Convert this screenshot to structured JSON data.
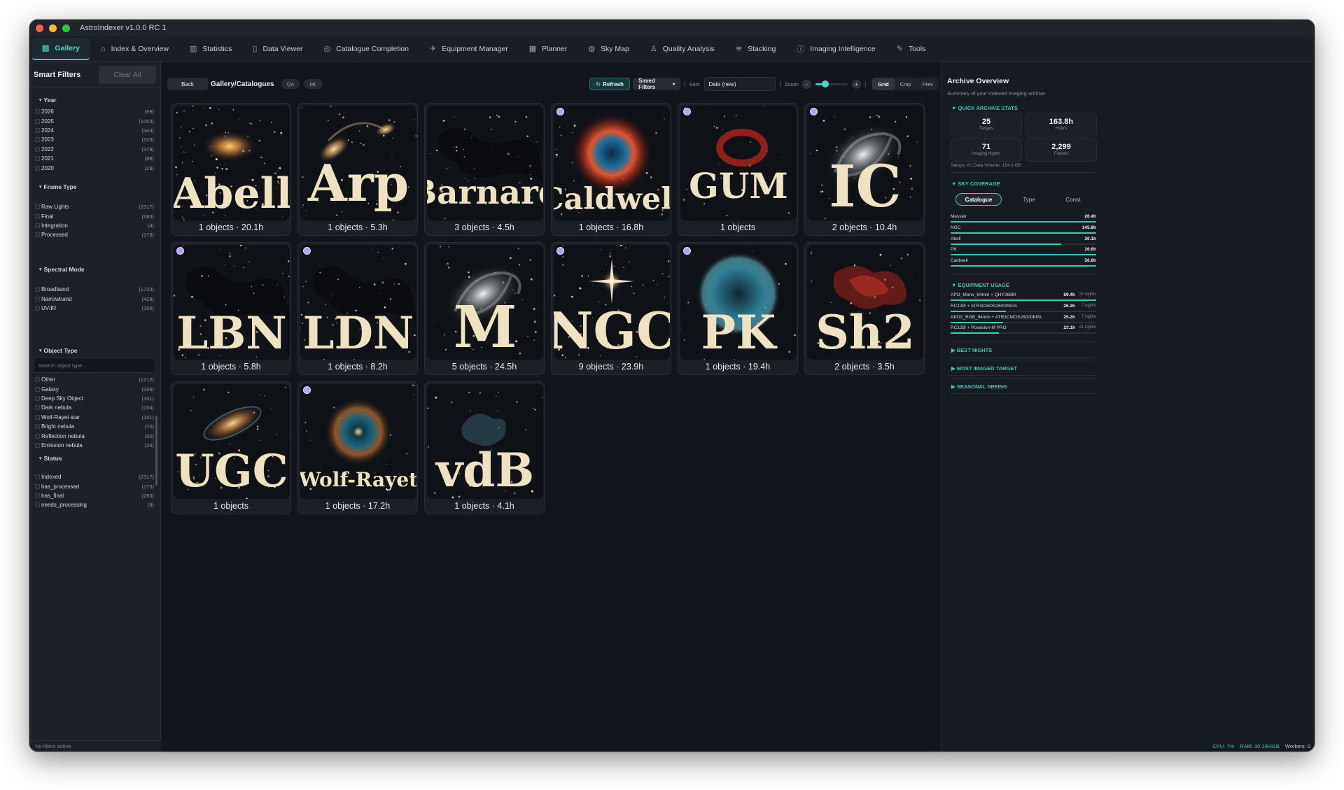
{
  "window": {
    "title": "AstroIndexer v1.0.0 RC 1"
  },
  "menu": [
    {
      "icon": "gallery-icon",
      "glyph": "▤",
      "label": "Gallery",
      "active": true
    },
    {
      "icon": "home-icon",
      "glyph": "⌂",
      "label": "Index & Overview"
    },
    {
      "icon": "bar-chart-icon",
      "glyph": "▥",
      "label": "Statistics"
    },
    {
      "icon": "file-icon",
      "glyph": "▯",
      "label": "Data Viewer"
    },
    {
      "icon": "target-icon",
      "glyph": "◎",
      "label": "Catalogue Completion"
    },
    {
      "icon": "telescope-icon",
      "glyph": "✈",
      "label": "Equipment Manager"
    },
    {
      "icon": "calendar-icon",
      "glyph": "▦",
      "label": "Planner"
    },
    {
      "icon": "globe-icon",
      "glyph": "◍",
      "label": "Sky Map"
    },
    {
      "icon": "flask-icon",
      "glyph": "♙",
      "label": "Quality Analysis"
    },
    {
      "icon": "layers-icon",
      "glyph": "≋",
      "label": "Stacking"
    },
    {
      "icon": "info-icon",
      "glyph": "ⓘ",
      "label": "Imaging Intelligence"
    },
    {
      "icon": "wrench-icon",
      "glyph": "✎",
      "label": "Tools"
    }
  ],
  "sidebar": {
    "title": "Smart Filters",
    "clear_label": "Clear All",
    "footer": "No filters active",
    "search_placeholder": "Search object type...",
    "sections": [
      {
        "title": "Year",
        "items": [
          {
            "label": "2026",
            "count": "(99)"
          },
          {
            "label": "2025",
            "count": "(1053)"
          },
          {
            "label": "2024",
            "count": "(344)"
          },
          {
            "label": "2023",
            "count": "(323)"
          },
          {
            "label": "2022",
            "count": "(379)"
          },
          {
            "label": "2021",
            "count": "(88)"
          },
          {
            "label": "2020",
            "count": "(28)"
          }
        ]
      },
      {
        "title": "Frame Type",
        "items": [
          {
            "label": "Raw Lights",
            "count": "(2317)"
          },
          {
            "label": "Final",
            "count": "(283)"
          },
          {
            "label": "Integration",
            "count": "(4)"
          },
          {
            "label": "Processed",
            "count": "(173)"
          }
        ]
      },
      {
        "title": "Spectral Mode",
        "items": [
          {
            "label": "Broadband",
            "count": "(1733)"
          },
          {
            "label": "Narrowband",
            "count": "(428)"
          },
          {
            "label": "UV/IR",
            "count": "(156)"
          }
        ]
      },
      {
        "title": "Object Type",
        "items": [
          {
            "label": "Other",
            "count": "(1212)"
          },
          {
            "label": "Galaxy",
            "count": "(335)"
          },
          {
            "label": "Deep Sky Object",
            "count": "(331)"
          },
          {
            "label": "Dark nebula",
            "count": "(154)"
          },
          {
            "label": "Wolf-Rayet star",
            "count": "(141)"
          },
          {
            "label": "Bright nebula",
            "count": "(70)"
          },
          {
            "label": "Reflection nebula",
            "count": "(50)"
          },
          {
            "label": "Emission nebula",
            "count": "(24)"
          }
        ]
      },
      {
        "title": "Status",
        "items": [
          {
            "label": "Indexed",
            "count": "(2317)"
          },
          {
            "label": "has_processed",
            "count": "(173)"
          },
          {
            "label": "has_final",
            "count": "(283)"
          },
          {
            "label": "needs_processing",
            "count": "(8)"
          }
        ]
      }
    ]
  },
  "toolbar": {
    "back_label": "Back",
    "breadcrumb": "Gallery/Catalogues",
    "qa_label": "QA",
    "ml_label": "ML",
    "refresh_label": "Refresh",
    "saved_label": "Saved Filters",
    "sort_label": "Sort:",
    "sort_value": "Date (new)",
    "zoom_label": "Zoom:",
    "zoom_minus": "-",
    "zoom_plus": "+",
    "zoom_level": 0.3,
    "views": [
      {
        "label": "Grid",
        "active": true
      },
      {
        "label": "Cmp"
      },
      {
        "label": "Prev"
      }
    ]
  },
  "catalogues": [
    {
      "name": "Abell",
      "stats": "1 objects  ·  20.1h",
      "art": "cluster",
      "badge": false
    },
    {
      "name": "Arp",
      "stats": "1 objects  ·  5.3h",
      "art": "interacting",
      "badge": false
    },
    {
      "name": "Barnard",
      "stats": "3 objects  ·  4.5h",
      "art": "dark",
      "badge": false
    },
    {
      "name": "Caldwell",
      "stats": "1 objects  ·  16.8h",
      "art": "helix",
      "badge": true
    },
    {
      "name": "GUM",
      "stats": "1 objects",
      "art": "redring",
      "badge": true
    },
    {
      "name": "IC",
      "stats": "2 objects  ·  10.4h",
      "art": "spiralgray",
      "badge": true
    },
    {
      "name": "LBN",
      "stats": "1 objects  ·  5.8h",
      "art": "dark",
      "badge": true
    },
    {
      "name": "LDN",
      "stats": "1 objects  ·  8.2h",
      "art": "dark",
      "badge": true
    },
    {
      "name": "M",
      "stats": "5 objects  ·  24.5h",
      "art": "spiralgray",
      "badge": false
    },
    {
      "name": "NGC",
      "stats": "9 objects  ·  23.9h",
      "art": "star",
      "badge": true
    },
    {
      "name": "PK",
      "stats": "1 objects  ·  19.4h",
      "art": "bluebubble",
      "badge": true
    },
    {
      "name": "Sh2",
      "stats": "2 objects  ·  3.5h",
      "art": "redcloud",
      "badge": false
    },
    {
      "name": "UGC",
      "stats": "1 objects",
      "art": "galaxy",
      "badge": false
    },
    {
      "name": "Wolf-Rayet",
      "stats": "1 objects  ·  17.2h",
      "art": "wr",
      "badge": true
    },
    {
      "name": "vdB",
      "stats": "1 objects  ·  4.1h",
      "art": "bluecloud",
      "badge": false
    }
  ],
  "overview": {
    "title": "Archive Overview",
    "subtitle": "Summary of your indexed imaging archive",
    "quick_title": "▼  QUICK ARCHIVE STATS",
    "stats": [
      {
        "value": "25",
        "label": "Targets"
      },
      {
        "value": "163.8h",
        "label": "Hours"
      },
      {
        "value": "71",
        "label": "Imaging Nights"
      },
      {
        "value": "2,299",
        "label": "Frames"
      }
    ],
    "setups": "Setups: 8 | Data Volume: 154.3 GB",
    "sky_title": "▼  SKY COVERAGE",
    "sky_tabs": [
      {
        "label": "Catalogue",
        "active": true
      },
      {
        "label": "Type"
      },
      {
        "label": "Const."
      }
    ],
    "sky_rows": [
      {
        "name": "Messier",
        "hours": "26.4h",
        "frac": 1.0
      },
      {
        "name": "NGC",
        "hours": "145.8h",
        "frac": 1.0
      },
      {
        "name": "Abell",
        "hours": "20.1h",
        "frac": 0.76
      },
      {
        "name": "PK",
        "hours": "26.6h",
        "frac": 1.0
      },
      {
        "name": "Caldwell",
        "hours": "56.6h",
        "frac": 1.0
      }
    ],
    "equip_title": "▼  EQUIPMENT USAGE",
    "equip_rows": [
      {
        "name": "APO_Mono_94mm + QHY268M",
        "hours": "69.4h",
        "nights": "37 nights",
        "frac": 1.0
      },
      {
        "name": "RC12Ø + ATR3CMOS26000KPA",
        "hours": "26.2h",
        "nights": "7 nights",
        "frac": 0.38
      },
      {
        "name": "APO2_RGB_94mm + ATR3CMOS26000KPA",
        "hours": "25.2h",
        "nights": "7 nights",
        "frac": 0.36
      },
      {
        "name": "RC12Ø + Poseidon-M PRO",
        "hours": "23.1h",
        "nights": "21 nights",
        "frac": 0.33
      }
    ],
    "collapsed": [
      "▶  BEST NIGHTS",
      "▶  MOST IMAGED TARGET",
      "▶  SEASONAL SEEING"
    ]
  },
  "status": {
    "cpu": "CPU: 7%",
    "ram": "RAM: 30.1/64GB",
    "workers": "Workers: 0"
  }
}
